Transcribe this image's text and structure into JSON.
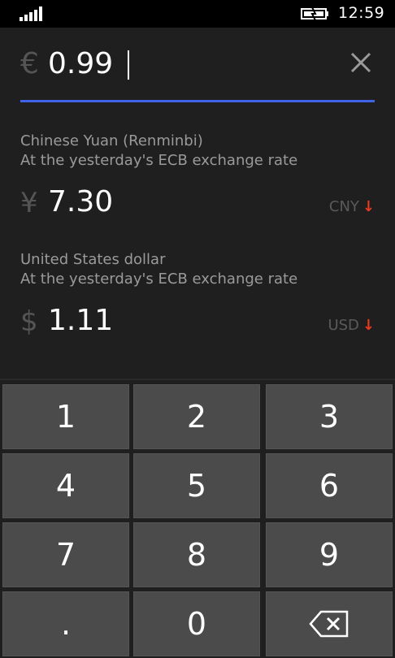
{
  "status_bar": {
    "time": "12:59",
    "signal_icon": "signal-strength-icon",
    "battery_icon": "battery-charging-icon"
  },
  "input": {
    "currency_symbol": "€",
    "value": "0.99",
    "clear_icon": "close-icon",
    "underline_color": "#3f63e6"
  },
  "results": [
    {
      "name": "Chinese Yuan (Renminbi)",
      "note": "At the yesterday's ECB exchange rate",
      "symbol": "¥",
      "value": "7.30",
      "code": "CNY",
      "trend_arrow": "↓",
      "trend_color": "#e63a21"
    },
    {
      "name": "United States dollar",
      "note": "At the yesterday's ECB exchange rate",
      "symbol": "$",
      "value": "1.11",
      "code": "USD",
      "trend_arrow": "↓",
      "trend_color": "#e63a21"
    }
  ],
  "keypad": {
    "keys": [
      "1",
      "2",
      "3",
      "4",
      "5",
      "6",
      "7",
      "8",
      "9",
      ".",
      "0"
    ],
    "backspace_icon": "backspace-icon"
  }
}
